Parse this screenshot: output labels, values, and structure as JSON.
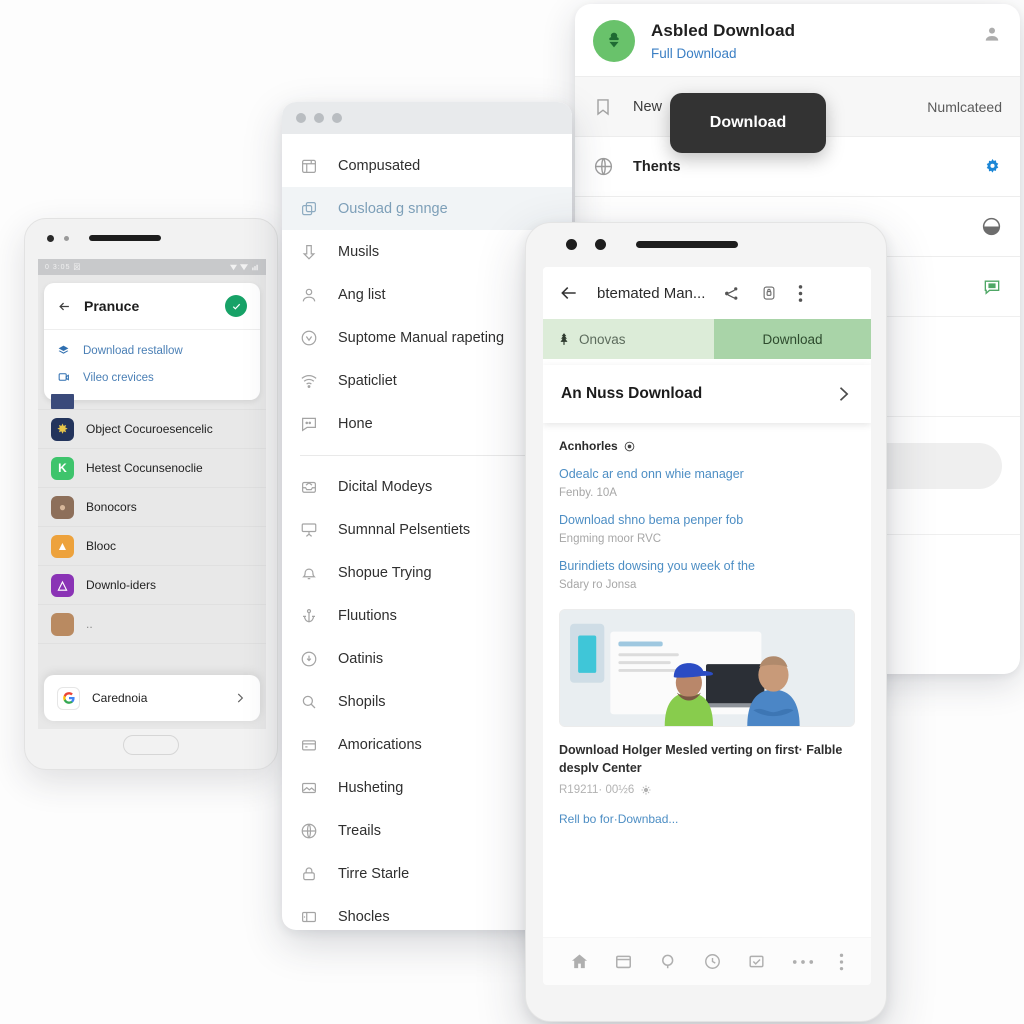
{
  "right_window": {
    "avatar_icon": "download-seedling-icon",
    "avatar_color": "#69c26b",
    "title": "Asbled Download",
    "subtitle": "Full Download",
    "subtitle_color": "#3b7fc4",
    "person_icon": "person-icon",
    "rows": [
      {
        "icon": "bookmark-icon",
        "label": "New",
        "right_label": "Numlcateed",
        "bold": false,
        "end_icon": ""
      },
      {
        "icon": "globe-icon",
        "label": "Thents",
        "right_label": "",
        "bold": true,
        "end_icon": "gear-blue-icon"
      },
      {
        "icon": "",
        "label": "",
        "right_label": "",
        "bold": false,
        "end_icon": "contrast-icon"
      },
      {
        "icon": "",
        "label": "",
        "right_label": "",
        "bold": false,
        "end_icon": "comment-green-icon"
      }
    ]
  },
  "tooltip": {
    "label": "Download",
    "background": "#333333"
  },
  "mid_window": {
    "window_dots": 3,
    "items": [
      {
        "label": "Compusated",
        "icon": "calendar-icon",
        "active": false
      },
      {
        "label": "Ousload g snnge",
        "icon": "copy-stack-icon",
        "active": true
      },
      {
        "label": "Musils",
        "icon": "download-arrow-icon",
        "active": false
      },
      {
        "label": "Ang list",
        "icon": "person-icon",
        "active": false
      },
      {
        "label": "Suptome Manual rapeting",
        "icon": "check-circle-icon",
        "active": false
      },
      {
        "label": "Spaticliet",
        "icon": "wifi-icon",
        "active": false
      },
      {
        "label": "Hone",
        "icon": "chat-icon",
        "active": false
      }
    ],
    "items2": [
      {
        "label": "Dicital Modeys",
        "icon": "inbox-icon",
        "active": false
      },
      {
        "label": "Sumnnal Pelsentiets",
        "icon": "presentation-icon",
        "active": false
      },
      {
        "label": "Shopue Trying",
        "icon": "bell-icon",
        "active": false
      },
      {
        "label": "Fluutions",
        "icon": "anchor-icon",
        "active": false
      },
      {
        "label": "Oatinis",
        "icon": "clock-download-icon",
        "active": false
      },
      {
        "label": "Shopils",
        "icon": "search-icon",
        "active": false
      },
      {
        "label": "Amorications",
        "icon": "archive-icon",
        "active": false
      },
      {
        "label": "Husheting",
        "icon": "image-icon",
        "active": false
      },
      {
        "label": "Treails",
        "icon": "globe-icon",
        "active": false
      },
      {
        "label": "Tirre Starle",
        "icon": "lock-icon",
        "active": false
      },
      {
        "label": "Shocles",
        "icon": "sidebar-icon",
        "active": false
      }
    ]
  },
  "left_phone": {
    "status_bar": {
      "left_text": "0 3:05 図",
      "signal_icons": "signal-wifi-battery"
    },
    "card": {
      "back_icon": "back-arrow-icon",
      "title": "Pranuce",
      "badge_icon": "check-icon",
      "badge_color": "#17a267",
      "links": [
        {
          "label": "Download restallow",
          "icon": "layers-icon"
        },
        {
          "label": "Vileo crevices",
          "icon": "video-icon"
        }
      ]
    },
    "apps": [
      {
        "label": "Object Cocuroesencelic",
        "icon_glyph": "✸",
        "icon_color": "#23345c"
      },
      {
        "label": "Hetest Cocunsenoclie",
        "icon_glyph": "K",
        "icon_color": "#3ec46c"
      },
      {
        "label": "Bonocors",
        "icon_glyph": "●",
        "icon_color": "#8d6f5a"
      },
      {
        "label": "Blooc",
        "icon_glyph": "▲",
        "icon_color": "#eda23c"
      },
      {
        "label": "Downlo-iders",
        "icon_glyph": "△",
        "icon_color": "#8a33b5"
      },
      {
        "label": "..",
        "icon_glyph": "",
        "icon_color": "#b98a61"
      }
    ],
    "bottom_item": {
      "label": "Carednoia",
      "icon": "google-g-icon",
      "chevron": "chevron-right-icon"
    }
  },
  "center_phone": {
    "appbar": {
      "back_icon": "back-arrow-icon",
      "title": "btemated Man...",
      "share_icon": "share-icon",
      "lock_icon": "lock-badge-icon",
      "more_icon": "more-vertical-icon"
    },
    "tabs": [
      {
        "label": "Onovas",
        "icon": "tree-icon",
        "active": false,
        "color": "#dcecd8"
      },
      {
        "label": "Download",
        "icon": "",
        "active": true,
        "color": "#a9d4a8"
      }
    ],
    "banner": {
      "label": "An Nuss Download",
      "chevron": "chevron-right-icon"
    },
    "section_title": "Acnhorles",
    "section_title_icon": "info-icon",
    "items": [
      {
        "link": "Odealc ar end onn whie manager",
        "sub": "Fenby. 10A"
      },
      {
        "link": "Download shno bema penper fob",
        "sub": "Engming moor RVC"
      },
      {
        "link": "Burindiets dowsing you week of the",
        "sub": "Sdary ro Jonsa"
      }
    ],
    "thumbnail": "two-men-with-computer-photo",
    "caption": "Download Holger Mesled verting on first· Falble desplv Center",
    "meta": "R19211· 00½6",
    "meta_icon": "sun-icon",
    "read_more": "Rell bo for·Downbad...",
    "navbar": [
      {
        "icon": "home-icon"
      },
      {
        "icon": "window-icon"
      },
      {
        "icon": "search-icon"
      },
      {
        "icon": "clock-icon"
      },
      {
        "icon": "checkbox-icon"
      },
      {
        "icon": "ellipsis-icon"
      },
      {
        "icon": "more-vertical-icon"
      }
    ]
  }
}
